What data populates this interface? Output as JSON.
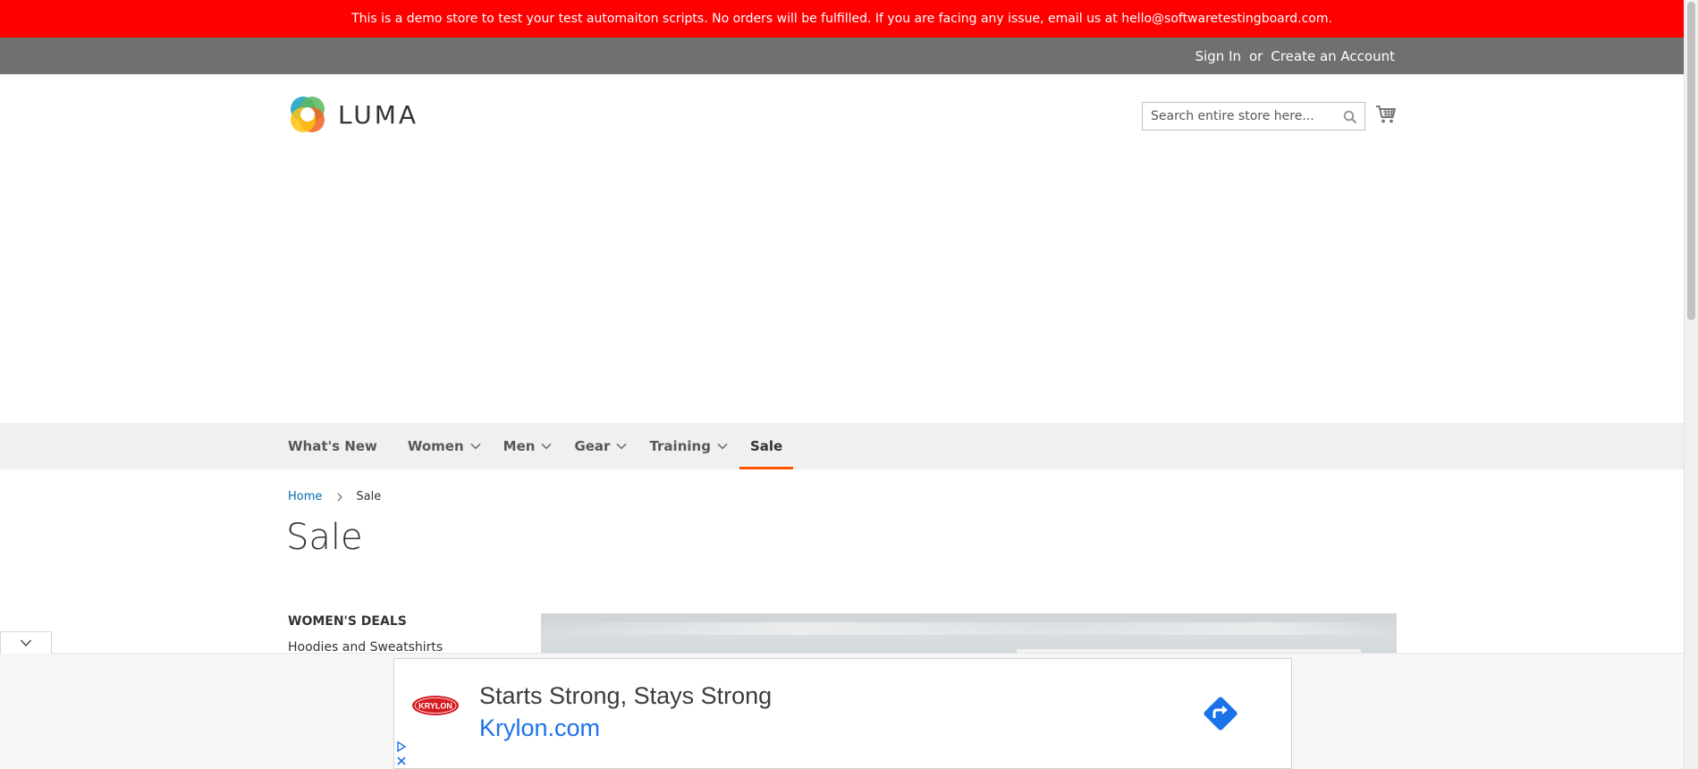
{
  "notice": {
    "text": "This is a demo store to test your test automaiton scripts. No orders will be fulfilled. If you are facing any issue, email us at hello@softwaretestingboard.com."
  },
  "header_links": {
    "sign_in": "Sign In",
    "separator": "or",
    "create_account": "Create an Account"
  },
  "logo": {
    "text": "LUMA"
  },
  "search": {
    "placeholder": "Search entire store here...",
    "value": ""
  },
  "nav": {
    "items": [
      {
        "label": "What's New",
        "has_dropdown": false,
        "active": false
      },
      {
        "label": "Women",
        "has_dropdown": true,
        "active": false
      },
      {
        "label": "Men",
        "has_dropdown": true,
        "active": false
      },
      {
        "label": "Gear",
        "has_dropdown": true,
        "active": false
      },
      {
        "label": "Training",
        "has_dropdown": true,
        "active": false
      },
      {
        "label": "Sale",
        "has_dropdown": false,
        "active": true
      }
    ]
  },
  "breadcrumb": {
    "home": "Home",
    "current": "Sale"
  },
  "page": {
    "title": "Sale"
  },
  "sidebar": {
    "section_title": "WOMEN'S DEALS",
    "links": [
      "Hoodies and Sweatshirts"
    ]
  },
  "ad": {
    "logo_text": "KRYLON",
    "headline": "Starts Strong, Stays Strong",
    "url": "Krylon.com"
  },
  "colors": {
    "notice_bg": "#ff0000",
    "panel_bg": "#6e716e",
    "nav_bg": "#f0f0f0",
    "active_underline": "#ff5501",
    "link": "#006bb4",
    "ad_url": "#1a73e8"
  },
  "icons": {
    "search": "search-icon",
    "cart": "cart-icon",
    "chevron": "chevron-down-icon",
    "breadcrumb_separator": "chevron-right-icon",
    "ad_arrow": "direction-arrow-icon",
    "ad_info": "ad-choices-icon",
    "ad_close": "close-icon"
  }
}
